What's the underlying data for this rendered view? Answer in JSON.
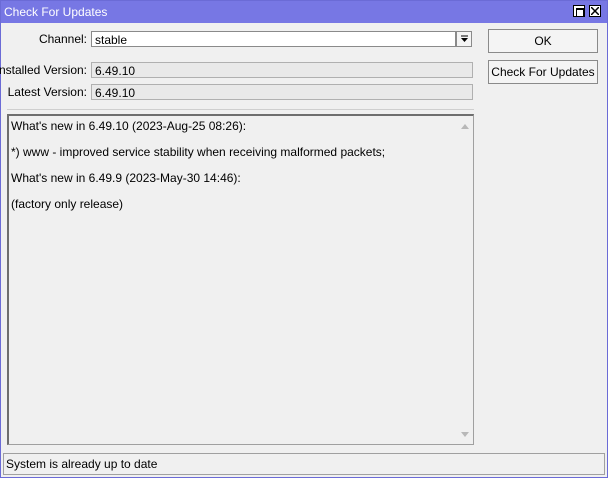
{
  "window": {
    "title": "Check For Updates"
  },
  "form": {
    "channel_label": "Channel:",
    "channel_value": "stable",
    "installed_label": "Installed Version:",
    "installed_value": "6.49.10",
    "latest_label": "Latest Version:",
    "latest_value": "6.49.10"
  },
  "buttons": {
    "ok": "OK",
    "check": "Check For Updates"
  },
  "notes": {
    "lines": [
      "What's new in 6.49.10 (2023-Aug-25 08:26):",
      "*) www - improved service stability when receiving malformed packets;",
      "What's new in 6.49.9  (2023-May-30 14:46):",
      "(factory only release)"
    ]
  },
  "status": {
    "text": "System is already up to date"
  }
}
